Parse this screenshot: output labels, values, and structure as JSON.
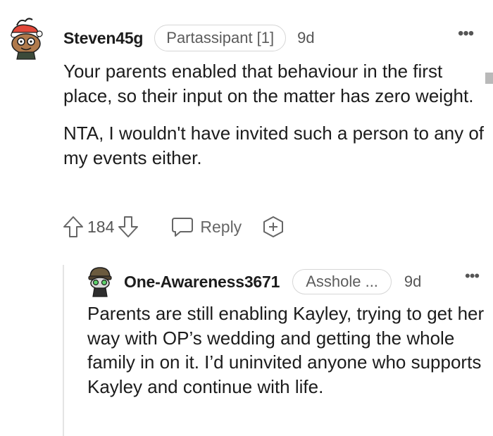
{
  "comment": {
    "username": "Steven45g",
    "flair": "Partassipant [1]",
    "age": "9d",
    "more_label": "•••",
    "paragraphs": [
      "Your parents enabled that behaviour in the first place, so their input on the matter has zero weight.",
      "NTA, I wouldn't have invited such a person to any of my events either."
    ],
    "votes": "184",
    "reply_label": "Reply",
    "avatar_icon": "snoo-avatar-santa-hat",
    "upvote_icon": "arrow-up-icon",
    "downvote_icon": "arrow-down-icon",
    "reply_icon": "speech-bubble-icon",
    "award_icon": "award-plus-icon"
  },
  "reply": {
    "username": "One-Awareness3671",
    "flair": "Asshole ...",
    "age": "9d",
    "more_label": "•••",
    "paragraphs": [
      "Parents are still enabling Kayley, trying to get her way with OP’s wedding and getting the whole family in on it. I’d uninvited anyone who supports Kayley and continue with life."
    ],
    "avatar_icon": "snoo-avatar-helmet"
  },
  "colors": {
    "text": "#1c1c1c",
    "muted": "#5c5c5c",
    "flair_border": "#d6d6d6",
    "thread_line": "#e4e4e4"
  }
}
